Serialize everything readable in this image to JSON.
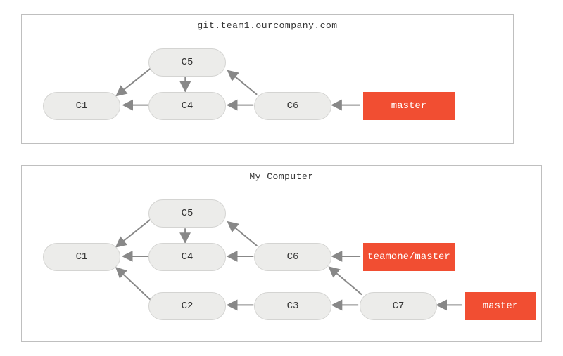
{
  "diagram": {
    "panels": [
      {
        "title": "git.team1.ourcompany.com",
        "commits": [
          "C1",
          "C4",
          "C5",
          "C6"
        ],
        "branches": [
          "master"
        ],
        "edges": [
          [
            "C4",
            "C1"
          ],
          [
            "C5",
            "C1"
          ],
          [
            "C5",
            "C4"
          ],
          [
            "C6",
            "C4"
          ],
          [
            "C6",
            "C5"
          ],
          [
            "master",
            "C6"
          ]
        ]
      },
      {
        "title": "My Computer",
        "commits": [
          "C1",
          "C2",
          "C3",
          "C4",
          "C5",
          "C6",
          "C7"
        ],
        "branches": [
          "teamone/master",
          "master"
        ],
        "edges": [
          [
            "C4",
            "C1"
          ],
          [
            "C5",
            "C1"
          ],
          [
            "C5",
            "C4"
          ],
          [
            "C2",
            "C1"
          ],
          [
            "C3",
            "C2"
          ],
          [
            "C6",
            "C4"
          ],
          [
            "C6",
            "C5"
          ],
          [
            "C7",
            "C3"
          ],
          [
            "C7",
            "C6"
          ],
          [
            "teamone/master",
            "C6"
          ],
          [
            "master",
            "C7"
          ]
        ]
      }
    ]
  },
  "colors": {
    "node_bg": "#ececea",
    "node_border": "#d4d4d2",
    "branch_bg": "#f14e32",
    "panel_border": "#bfbfbf",
    "arrow": "#888888"
  }
}
